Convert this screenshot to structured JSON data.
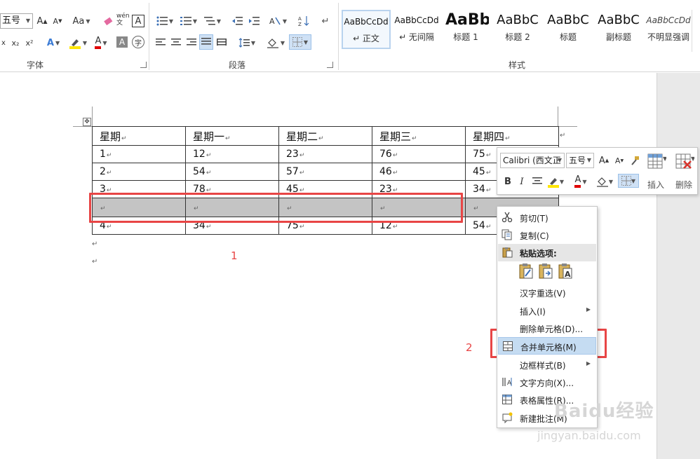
{
  "ribbon": {
    "font_group": {
      "label": "字体",
      "font_size": "五号",
      "grow_font": "A",
      "shrink_font": "A",
      "change_case": "Aa",
      "phonetic_guide": "wén 文",
      "char_border": "A",
      "subscript": "x₂",
      "superscript": "x²",
      "text_effects": "A",
      "font_color": "A",
      "char_shading": "A",
      "enclose_chars": "字"
    },
    "paragraph_group": {
      "label": "段落"
    },
    "styles_group": {
      "label": "样式",
      "items": [
        {
          "sample": "AaBbCcDd",
          "name": "↵ 正文"
        },
        {
          "sample": "AaBbCcDd",
          "name": "↵ 无间隔"
        },
        {
          "sample": "AaBb",
          "name": "标题 1"
        },
        {
          "sample": "AaBbC",
          "name": "标题 2"
        },
        {
          "sample": "AaBbC",
          "name": "标题"
        },
        {
          "sample": "AaBbC",
          "name": "副标题"
        },
        {
          "sample": "AaBbCcDd",
          "name": "不明显强调"
        }
      ]
    }
  },
  "table": {
    "header": [
      "星期",
      "星期一",
      "星期二",
      "星期三",
      "星期四"
    ],
    "rows": [
      [
        "1",
        "12",
        "23",
        "76",
        "75"
      ],
      [
        "2",
        "54",
        "57",
        "46",
        "45"
      ],
      [
        "3",
        "78",
        "45",
        "23",
        "34"
      ],
      [
        "",
        "",
        "",
        "",
        ""
      ],
      [
        "4",
        "34",
        "75",
        "12",
        "54"
      ]
    ],
    "selected_row_index": 3
  },
  "paragraph_mark": "↵",
  "annotations": {
    "label_1": "1",
    "label_2": "2",
    "box_color": "#e84545"
  },
  "mini_toolbar": {
    "font_name": "Calibri (西文正",
    "font_size": "五号",
    "grow_font": "A",
    "shrink_font": "A",
    "bold": "B",
    "italic": "I",
    "font_color": "A",
    "insert_label": "插入",
    "delete_label": "删除"
  },
  "context_menu": {
    "items": [
      {
        "label": "剪切(T)",
        "icon": "scissors-icon"
      },
      {
        "label": "复制(C)",
        "icon": "copy-icon"
      },
      {
        "label": "粘贴选项:",
        "icon": "paste-icon"
      },
      {
        "label": "汉字重选(V)",
        "icon": ""
      },
      {
        "label": "插入(I)",
        "icon": "",
        "submenu": true
      },
      {
        "label": "删除单元格(D)...",
        "icon": ""
      },
      {
        "label": "合并单元格(M)",
        "icon": "merge-cells-icon",
        "highlight": true
      },
      {
        "label": "边框样式(B)",
        "icon": "",
        "submenu": true
      },
      {
        "label": "文字方向(X)...",
        "icon": "text-direction-icon"
      },
      {
        "label": "表格属性(R)...",
        "icon": "table-properties-icon"
      },
      {
        "label": "新建批注(M)",
        "icon": "new-comment-icon"
      }
    ]
  },
  "watermark": {
    "logo_text": "Baidu经验",
    "url": "jingyan.baidu.com"
  },
  "colors": {
    "accent": "#2b579a",
    "selection": "#c4c4c4",
    "highlight": "#c5dcf2",
    "annotation": "#e84545"
  }
}
